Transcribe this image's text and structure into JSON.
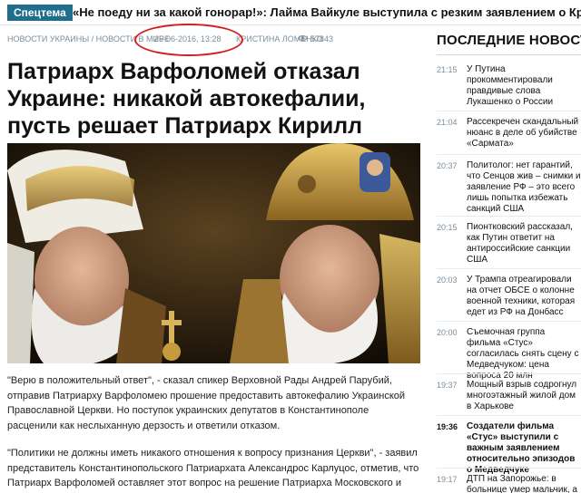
{
  "ticker": {
    "badge": "Спецтема",
    "text": "«Не поеду ни за какой гонорар!»: Лайма Вайкуле выступила с резким заявлением о Крыме"
  },
  "meta": {
    "breadcrumb": "НОВОСТИ УКРАИНЫ / НОВОСТИ В МИРЕ",
    "date": "25-06-2016, 13:28",
    "author": "КРИСТИНА ЛОМЕНКО",
    "views": "57843"
  },
  "article": {
    "title": "Патриарх Варфоломей отказал Украине: никакой автокефалии, пусть решает Патриарх Кирилл",
    "paragraph1": "\"Верю в положительный ответ\", - сказал спикер Верховной Рады Андрей Парубий, отправив Патриарху Варфоломею прошение предоставить автокефалию Украинской Православной Церкви. Но поступок украинских депутатов в Константинополе расценили как неслыханную дерзость и ответили отказом.",
    "paragraph2": "\"Политики не должны иметь никакого отношения к вопросу признания Церкви\", - заявил представитель Константинопольского Патриархата Александрос Карлуцос, отметив, что Патриарх Варфоломей оставляет этот вопрос на решение Патриарха Московского и всея Руси"
  },
  "sidebar": {
    "title": "ПОСЛЕДНИЕ НОВОСТИ",
    "items": [
      {
        "time": "21:15",
        "text": "У Путина прокомментировали правдивые слова Лукашенко о России"
      },
      {
        "time": "21:04",
        "text": "Рассекречен скандальный нюанс в деле об убийстве «Сармата»"
      },
      {
        "time": "20:37",
        "text": "Политолог: нет гарантий, что Сенцов жив – снимки и заявление РФ – это всего лишь попытка избежать санкций США"
      },
      {
        "time": "20:15",
        "text": "Пионтковский рассказал, как Путин ответит на антироссийские санкции США"
      },
      {
        "time": "20:03",
        "text": "У Трампа отреагировали на отчет ОБСЕ о колонне военной техники, которая едет из РФ на Донбасс"
      },
      {
        "time": "20:00",
        "text": "Съемочная группа фильма «Стус» согласилась снять сцену с Медведчуком: цена вопроса 20 млн"
      },
      {
        "time": "19:37",
        "text": "Мощный взрыв содрогнул многоэтажный жилой дом в Харькове"
      },
      {
        "time": "19:36",
        "text": "Создатели фильма «Стус» выступили с важным заявлением относительно эпизодов о Медведчуке"
      },
      {
        "time": "19:17",
        "text": "ДТП на Запорожье: в больнице умер мальчик, а"
      }
    ]
  },
  "colors": {
    "badge_bg": "#1f6e8c",
    "meta_text": "#7b8e9c",
    "highlight_circle": "#d21d1d"
  },
  "icons": {
    "views": "eye-icon"
  }
}
